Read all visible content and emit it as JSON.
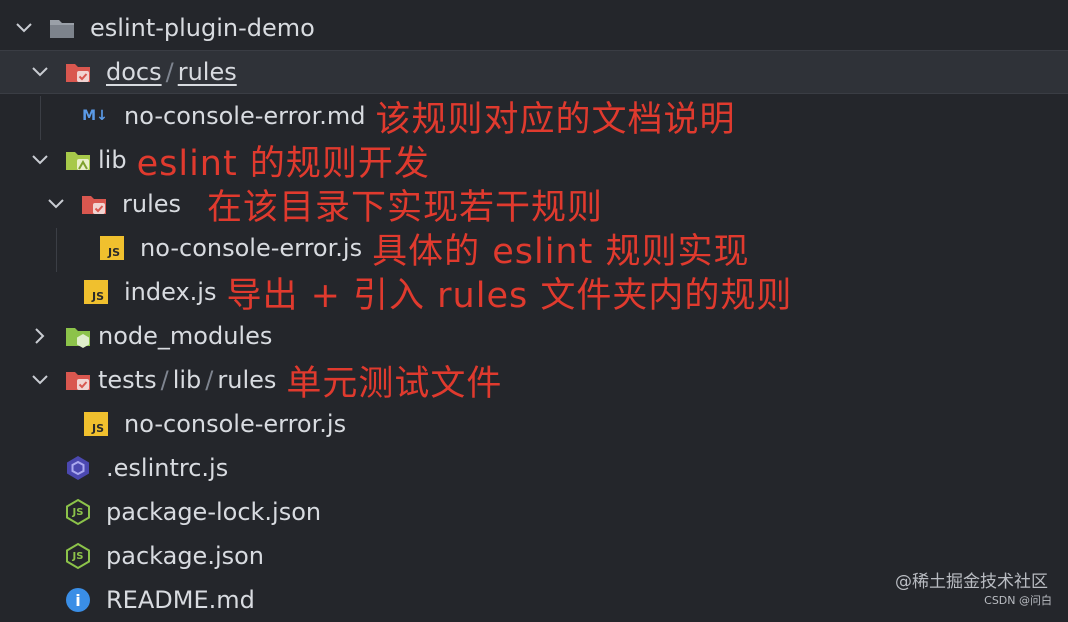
{
  "root": {
    "label": "eslint-plugin-demo",
    "icon": "folder-icon"
  },
  "docs": {
    "parts": [
      "docs",
      "rules"
    ],
    "icon": "folder-docs-icon"
  },
  "docs_file": {
    "label": "no-console-error.md",
    "icon_text": "M↓",
    "note": "该规则对应的文档说明"
  },
  "lib": {
    "label": "lib",
    "note": "eslint 的规则开发",
    "icon": "folder-lib-icon"
  },
  "lib_rules": {
    "label": "rules",
    "note": "在该目录下实现若干规则",
    "icon": "folder-rules-icon"
  },
  "lib_rules_file": {
    "label": "no-console-error.js",
    "icon_text": "JS",
    "note": "具体的 eslint 规则实现"
  },
  "lib_index": {
    "label": "index.js",
    "icon_text": "JS",
    "note": "导出 + 引入 rules 文件夹内的规则"
  },
  "node_modules": {
    "label": "node_modules",
    "icon": "folder-node-icon"
  },
  "tests": {
    "parts": [
      "tests",
      "lib",
      "rules"
    ],
    "note": "单元测试文件",
    "icon": "folder-tests-icon"
  },
  "tests_file": {
    "label": "no-console-error.js",
    "icon_text": "JS"
  },
  "eslintrc": {
    "label": ".eslintrc.js",
    "icon": "eslint-icon"
  },
  "package_lock": {
    "label": "package-lock.json",
    "icon": "node-json-icon",
    "icon_text": "JS"
  },
  "package": {
    "label": "package.json",
    "icon": "node-json-icon",
    "icon_text": "JS"
  },
  "readme": {
    "label": "README.md",
    "icon": "info-icon",
    "icon_text": "i"
  },
  "watermark": {
    "line1": "@稀土掘金技术社区",
    "line2": "CSDN @问白"
  },
  "colors": {
    "background": "#24262b",
    "annotation": "#e03a2e",
    "js_badge": "#f0c02e",
    "folder_red": "#d9574f",
    "folder_green": "#8cc34a",
    "eslint": "#4b48b0",
    "info": "#3a8ee6"
  }
}
